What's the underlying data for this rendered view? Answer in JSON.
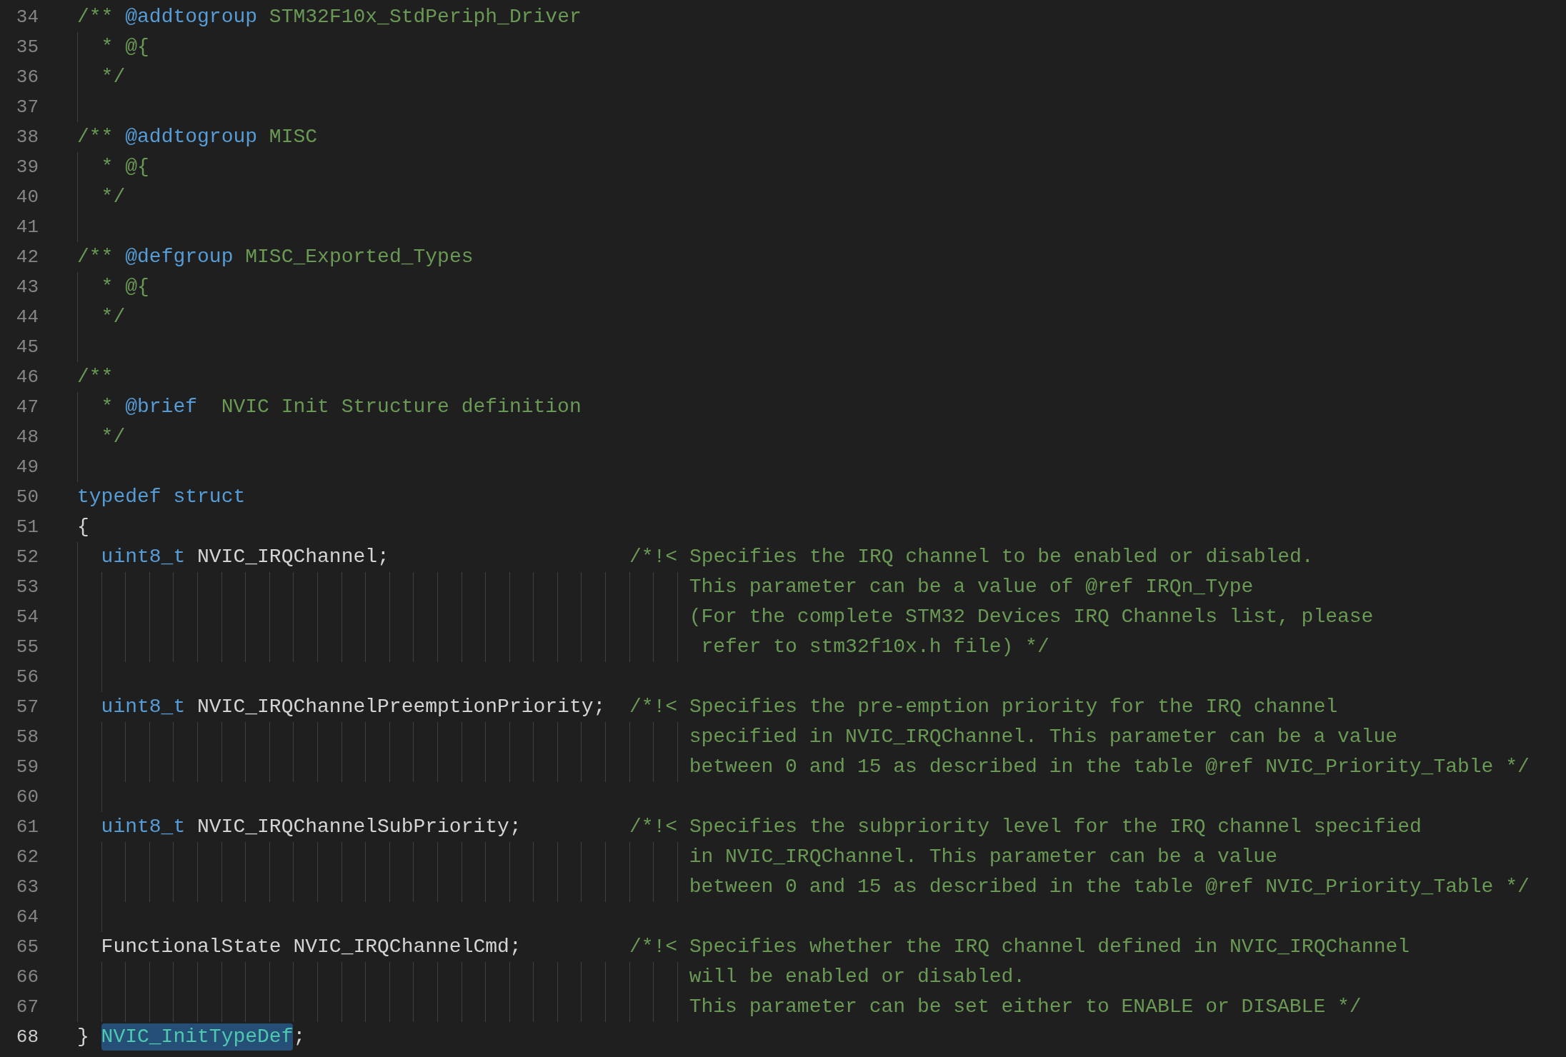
{
  "lines": [
    {
      "number": "34",
      "current": false,
      "kind": "top",
      "tokens": [
        {
          "kind": "comment",
          "text": "/** "
        },
        {
          "kind": "tag",
          "text": "@addtogroup"
        },
        {
          "kind": "comment",
          "text": " STM32F10x_StdPeriph_Driver"
        }
      ]
    },
    {
      "number": "35",
      "current": false,
      "kind": "inner",
      "tokens": [
        {
          "kind": "comment",
          "text": "* @{"
        }
      ]
    },
    {
      "number": "36",
      "current": false,
      "kind": "inner",
      "tokens": [
        {
          "kind": "comment",
          "text": "*/"
        }
      ]
    },
    {
      "number": "37",
      "current": false,
      "kind": "blank"
    },
    {
      "number": "38",
      "current": false,
      "kind": "top",
      "tokens": [
        {
          "kind": "comment",
          "text": "/** "
        },
        {
          "kind": "tag",
          "text": "@addtogroup"
        },
        {
          "kind": "comment",
          "text": " MISC"
        }
      ]
    },
    {
      "number": "39",
      "current": false,
      "kind": "inner",
      "tokens": [
        {
          "kind": "comment",
          "text": "* @{"
        }
      ]
    },
    {
      "number": "40",
      "current": false,
      "kind": "inner",
      "tokens": [
        {
          "kind": "comment",
          "text": "*/"
        }
      ]
    },
    {
      "number": "41",
      "current": false,
      "kind": "blank"
    },
    {
      "number": "42",
      "current": false,
      "kind": "top",
      "tokens": [
        {
          "kind": "comment",
          "text": "/** "
        },
        {
          "kind": "tag",
          "text": "@defgroup"
        },
        {
          "kind": "comment",
          "text": " MISC_Exported_Types"
        }
      ]
    },
    {
      "number": "43",
      "current": false,
      "kind": "inner",
      "tokens": [
        {
          "kind": "comment",
          "text": "* @{"
        }
      ]
    },
    {
      "number": "44",
      "current": false,
      "kind": "inner",
      "tokens": [
        {
          "kind": "comment",
          "text": "*/"
        }
      ]
    },
    {
      "number": "45",
      "current": false,
      "kind": "blank"
    },
    {
      "number": "46",
      "current": false,
      "kind": "top",
      "tokens": [
        {
          "kind": "comment",
          "text": "/**"
        }
      ]
    },
    {
      "number": "47",
      "current": false,
      "kind": "inner",
      "tokens": [
        {
          "kind": "comment",
          "text": "* "
        },
        {
          "kind": "tag",
          "text": "@brief"
        },
        {
          "kind": "comment",
          "text": "  NVIC Init Structure definition"
        }
      ]
    },
    {
      "number": "48",
      "current": false,
      "kind": "inner",
      "tokens": [
        {
          "kind": "comment",
          "text": "*/"
        }
      ]
    },
    {
      "number": "49",
      "current": false,
      "kind": "blank"
    },
    {
      "number": "50",
      "current": false,
      "kind": "top",
      "tokens": [
        {
          "kind": "keyword",
          "text": "typedef struct"
        }
      ]
    },
    {
      "number": "51",
      "current": false,
      "kind": "top",
      "tokens": [
        {
          "kind": "plain",
          "text": "{"
        }
      ]
    },
    {
      "number": "52",
      "current": false,
      "kind": "member",
      "tokens": [
        {
          "kind": "type",
          "text": "uint8_t "
        },
        {
          "kind": "plain",
          "text": "NVIC_IRQChannel;"
        }
      ],
      "comment": "/*!< Specifies the IRQ channel to be enabled or disabled."
    },
    {
      "number": "53",
      "current": false,
      "kind": "continuation",
      "tokens": [
        {
          "kind": "comment",
          "text": "This parameter can be a value of @ref IRQn_Type"
        }
      ]
    },
    {
      "number": "54",
      "current": false,
      "kind": "continuation",
      "tokens": [
        {
          "kind": "comment",
          "text": "(For the complete STM32 Devices IRQ Channels list, please"
        }
      ]
    },
    {
      "number": "55",
      "current": false,
      "kind": "continuation",
      "tokens": [
        {
          "kind": "comment",
          "text": " refer to stm32f10x.h file) */"
        }
      ]
    },
    {
      "number": "56",
      "current": false,
      "kind": "blank"
    },
    {
      "number": "57",
      "current": false,
      "kind": "member",
      "tokens": [
        {
          "kind": "type",
          "text": "uint8_t "
        },
        {
          "kind": "plain",
          "text": "NVIC_IRQChannelPreemptionPriority;"
        }
      ],
      "comment": "/*!< Specifies the pre-emption priority for the IRQ channel"
    },
    {
      "number": "58",
      "current": false,
      "kind": "continuation",
      "tokens": [
        {
          "kind": "comment",
          "text": "specified in NVIC_IRQChannel. This parameter can be a value"
        }
      ]
    },
    {
      "number": "59",
      "current": false,
      "kind": "continuation",
      "tokens": [
        {
          "kind": "comment",
          "text": "between 0 and 15 as described in the table @ref NVIC_Priority_Table */"
        }
      ]
    },
    {
      "number": "60",
      "current": false,
      "kind": "blank"
    },
    {
      "number": "61",
      "current": false,
      "kind": "member",
      "tokens": [
        {
          "kind": "type",
          "text": "uint8_t "
        },
        {
          "kind": "plain",
          "text": "NVIC_IRQChannelSubPriority;"
        }
      ],
      "comment": "/*!< Specifies the subpriority level for the IRQ channel specified"
    },
    {
      "number": "62",
      "current": false,
      "kind": "continuation",
      "tokens": [
        {
          "kind": "comment",
          "text": "in NVIC_IRQChannel. This parameter can be a value"
        }
      ]
    },
    {
      "number": "63",
      "current": false,
      "kind": "continuation",
      "tokens": [
        {
          "kind": "comment",
          "text": "between 0 and 15 as described in the table @ref NVIC_Priority_Table */"
        }
      ]
    },
    {
      "number": "64",
      "current": false,
      "kind": "blank"
    },
    {
      "number": "65",
      "current": false,
      "kind": "member",
      "tokens": [
        {
          "kind": "plain",
          "text": "FunctionalState NVIC_IRQChannelCmd;"
        }
      ],
      "comment": "/*!< Specifies whether the IRQ channel defined in NVIC_IRQChannel"
    },
    {
      "number": "66",
      "current": false,
      "kind": "continuation",
      "tokens": [
        {
          "kind": "comment",
          "text": "will be enabled or disabled."
        }
      ]
    },
    {
      "number": "67",
      "current": false,
      "kind": "continuation",
      "tokens": [
        {
          "kind": "comment",
          "text": "This parameter can be set either to ENABLE or DISABLE */"
        }
      ]
    },
    {
      "number": "68",
      "current": true,
      "kind": "top",
      "tokens": [
        {
          "kind": "plain",
          "text": "} "
        },
        {
          "kind": "highlighted_type",
          "text": "NVIC_InitTypeDef"
        },
        {
          "kind": "plain",
          "text": ";"
        }
      ]
    }
  ]
}
